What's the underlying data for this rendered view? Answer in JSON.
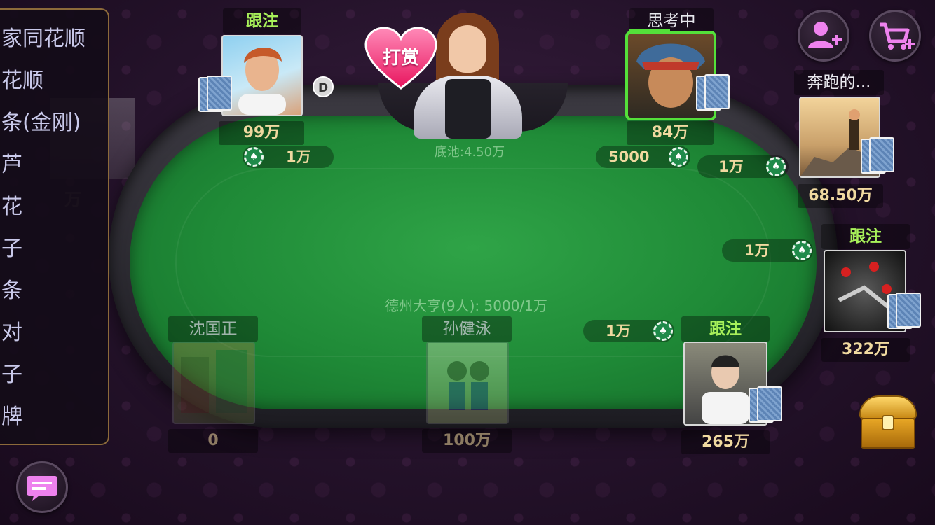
{
  "dealer": {
    "tip_label": "打赏"
  },
  "table": {
    "pot_label": "底池:4.50万",
    "title": "德州大亨(9人): 5000/1万"
  },
  "hand_rankings": [
    "家同花顺",
    "花顺",
    "条(金刚)",
    "芦",
    "花",
    "子",
    "条",
    "对",
    "子",
    "牌"
  ],
  "players": {
    "top_left": {
      "status": "跟注",
      "money": "99万",
      "bet": "1万",
      "dealer_button": "D"
    },
    "top_right": {
      "status": "思考中",
      "money": "84万",
      "bet": "5000"
    },
    "right_top": {
      "name": "奔跑的...",
      "money": "68.50万",
      "bet": "1万"
    },
    "right_mid": {
      "status": "跟注",
      "money": "322万",
      "bet": "1万"
    },
    "bottom_right": {
      "status": "跟注",
      "money": "265万",
      "bet": "1万"
    },
    "bottom_center": {
      "name": "孙健泳",
      "money": "100万"
    },
    "bottom_left": {
      "name": "沈国正",
      "money": "0"
    }
  },
  "partial_left_money": "万",
  "colors": {
    "felt": "#1f8a37",
    "status_green": "#a8f05a",
    "money_gold": "#f0d9a0",
    "active_border": "#54e03a",
    "tip_heart": "#ff4f8f",
    "icon_pink": "#ee82ee"
  },
  "icons": [
    "add-friend-icon",
    "shop-cart-icon",
    "chat-icon",
    "treasure-chest-icon",
    "chip-icon"
  ]
}
